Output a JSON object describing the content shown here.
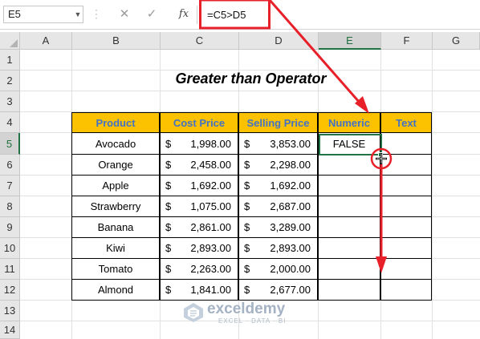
{
  "formula_bar": {
    "name_box": "E5",
    "cancel_icon": "✕",
    "enter_icon": "✓",
    "fx_label": "fx",
    "formula": "=C5>D5"
  },
  "columns": [
    "A",
    "B",
    "C",
    "D",
    "E",
    "F",
    "G"
  ],
  "rows": [
    "1",
    "2",
    "3",
    "4",
    "5",
    "6",
    "7",
    "8",
    "9",
    "10",
    "11",
    "12",
    "13",
    "14"
  ],
  "selected_cell": "E5",
  "sheet": {
    "title": "Greater than Operator",
    "headers": [
      "Product",
      "Cost Price",
      "Selling Price",
      "Numeric",
      "Text"
    ],
    "currency": "$",
    "data": [
      {
        "product": "Avocado",
        "cost": "1,998.00",
        "selling": "3,853.00",
        "numeric": "FALSE",
        "text": ""
      },
      {
        "product": "Orange",
        "cost": "2,458.00",
        "selling": "2,298.00",
        "numeric": "",
        "text": ""
      },
      {
        "product": "Apple",
        "cost": "1,692.00",
        "selling": "1,692.00",
        "numeric": "",
        "text": ""
      },
      {
        "product": "Strawberry",
        "cost": "1,075.00",
        "selling": "2,687.00",
        "numeric": "",
        "text": ""
      },
      {
        "product": "Banana",
        "cost": "2,861.00",
        "selling": "3,289.00",
        "numeric": "",
        "text": ""
      },
      {
        "product": "Kiwi",
        "cost": "2,893.00",
        "selling": "2,893.00",
        "numeric": "",
        "text": ""
      },
      {
        "product": "Tomato",
        "cost": "2,263.00",
        "selling": "2,000.00",
        "numeric": "",
        "text": ""
      },
      {
        "product": "Almond",
        "cost": "1,841.00",
        "selling": "2,677.00",
        "numeric": "",
        "text": ""
      }
    ]
  },
  "watermark": {
    "name": "exceldemy",
    "tagline": "EXCEL · DATA · BI"
  },
  "colors": {
    "header_fill": "#fcc200",
    "header_text": "#4472c4",
    "selection": "#217346",
    "annotation": "#e8202a"
  }
}
